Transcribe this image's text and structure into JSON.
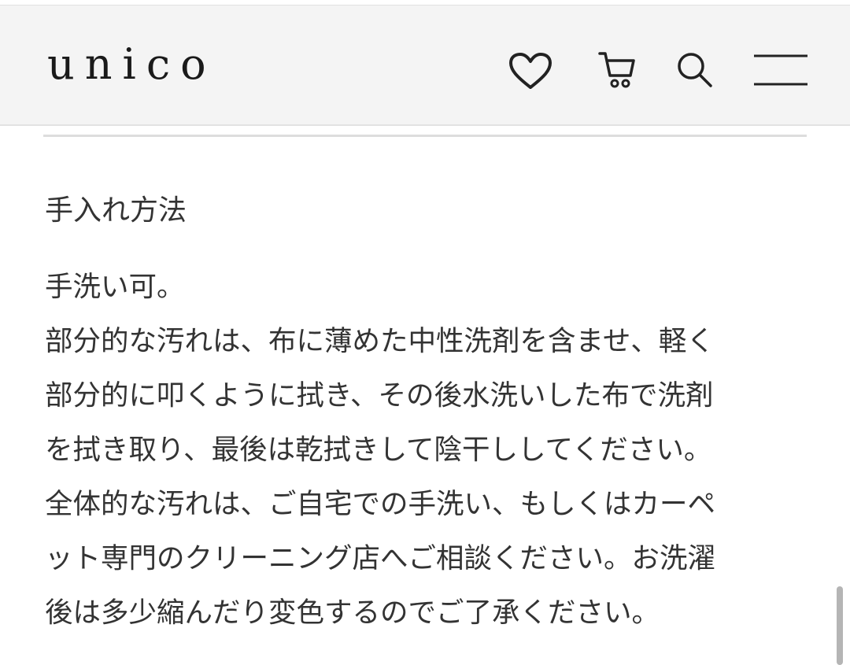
{
  "header": {
    "logo": "unico",
    "icons": [
      "heart-icon",
      "cart-icon",
      "search-icon",
      "menu-icon"
    ]
  },
  "care": {
    "title": "手入れ方法",
    "lines": [
      "手洗い可。",
      "部分的な汚れは、布に薄めた中性洗剤を含ませ、軽く",
      "部分的に叩くように拭き、その後水洗いした布で洗剤",
      "を拭き取り、最後は乾拭きして陰干ししてください。",
      "全体的な汚れは、ご自宅での手洗い、もしくはカーペ",
      "ット専門のクリーニング店へご相談ください。お洗濯",
      "後は多少縮んだり変色するのでご了承ください。"
    ]
  },
  "colors": {
    "header_bg": "#f4f4f4",
    "text": "#333333",
    "icon": "#222222"
  }
}
